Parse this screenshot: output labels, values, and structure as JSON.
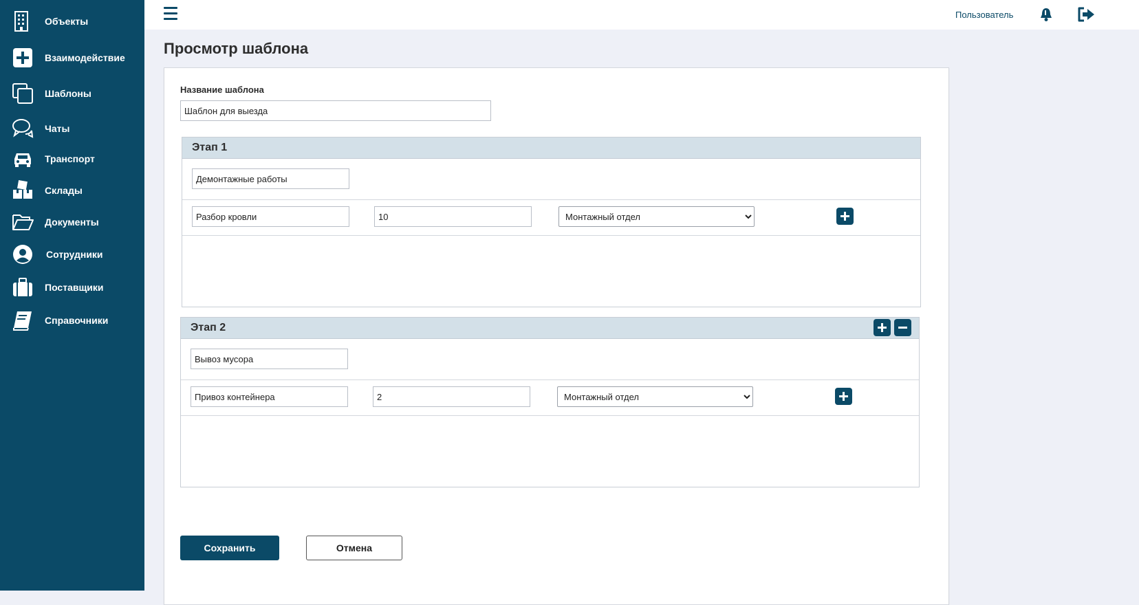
{
  "sidebar": {
    "items": [
      {
        "label": "Объекты",
        "icon": "building-icon"
      },
      {
        "label": "Взаимодействие",
        "icon": "plus-square-icon"
      },
      {
        "label": "Шаблоны",
        "icon": "copy-icon"
      },
      {
        "label": "Чаты",
        "icon": "chat-icon"
      },
      {
        "label": "Транспорт",
        "icon": "car-icon"
      },
      {
        "label": "Склады",
        "icon": "boxes-icon"
      },
      {
        "label": "Документы",
        "icon": "folder-open-icon"
      },
      {
        "label": "Сотрудники",
        "icon": "user-circle-icon"
      },
      {
        "label": "Поставщики",
        "icon": "briefcase-icon"
      },
      {
        "label": "Справочники",
        "icon": "book-icon"
      }
    ]
  },
  "header": {
    "user_label": "Пользователь",
    "icons": [
      "menu-icon",
      "bell-icon",
      "logout-icon"
    ]
  },
  "page": {
    "title": "Просмотр шаблона"
  },
  "form": {
    "name_label": "Название шаблона",
    "name_value": "Шаблон для выезда",
    "stages": [
      {
        "title": "Этап 1",
        "name": "Демонтажные работы",
        "task": {
          "name": "Разбор кровли",
          "quantity": "10",
          "department": "Монтажный отдел"
        }
      },
      {
        "title": "Этап 2",
        "name": "Вывоз мусора",
        "task": {
          "name": "Привоз контейнера",
          "quantity": "2",
          "department": "Монтажный отдел"
        }
      }
    ],
    "save_label": "Сохранить",
    "cancel_label": "Отмена"
  },
  "colors": {
    "brand": "#0b4a67",
    "page_bg": "#eef0f7",
    "stage_header_bg": "#d3e0e8"
  }
}
